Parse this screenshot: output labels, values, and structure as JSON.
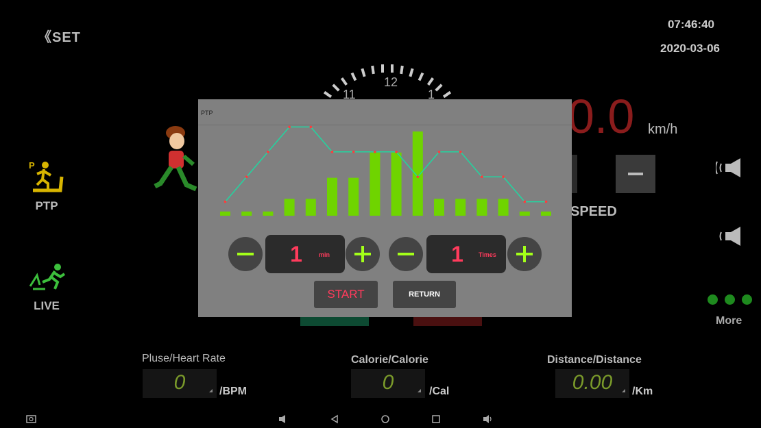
{
  "header": {
    "back_label": "SET",
    "time": "07:46:40",
    "date": "2020-03-06"
  },
  "left_modes": [
    {
      "label": "PTP",
      "icon": "ptp-treadmill-icon"
    },
    {
      "label": "LIVE",
      "icon": "live-run-icon"
    }
  ],
  "dial": {
    "numbers": [
      "11",
      "12",
      "1"
    ]
  },
  "speed": {
    "value": "0.0",
    "unit": "km/h",
    "label": "SPEED"
  },
  "more": {
    "label": "More"
  },
  "stats": [
    {
      "title": "Pluse/Heart Rate",
      "value": "0",
      "unit": "/BPM"
    },
    {
      "title": "Calorie/Calorie",
      "value": "0",
      "unit": "/Cal"
    },
    {
      "title": "Distance/Distance",
      "value": "0.00",
      "unit": "/Km"
    }
  ],
  "dialog": {
    "title": "PTP",
    "time_value": "1",
    "time_unit": "min",
    "times_value": "1",
    "times_unit": "Times",
    "start_label": "START",
    "return_label": "RETURN"
  },
  "chart_data": {
    "type": "bar",
    "bar_levels": [
      1,
      1,
      1,
      4,
      4,
      9,
      9,
      15,
      15,
      20,
      4,
      4,
      4,
      4,
      1,
      1
    ],
    "line_levels": [
      2,
      9,
      16,
      23,
      23,
      16,
      16,
      16,
      16,
      9,
      16,
      16,
      9,
      9,
      2,
      2
    ],
    "colors": {
      "bars": "#6fd400",
      "line": "#21d6a0",
      "points": "#ff3b3b"
    }
  },
  "colors": {
    "accent_green": "#a3ff19",
    "accent_red": "#ff3b5c",
    "dialog_bg": "#808080"
  }
}
